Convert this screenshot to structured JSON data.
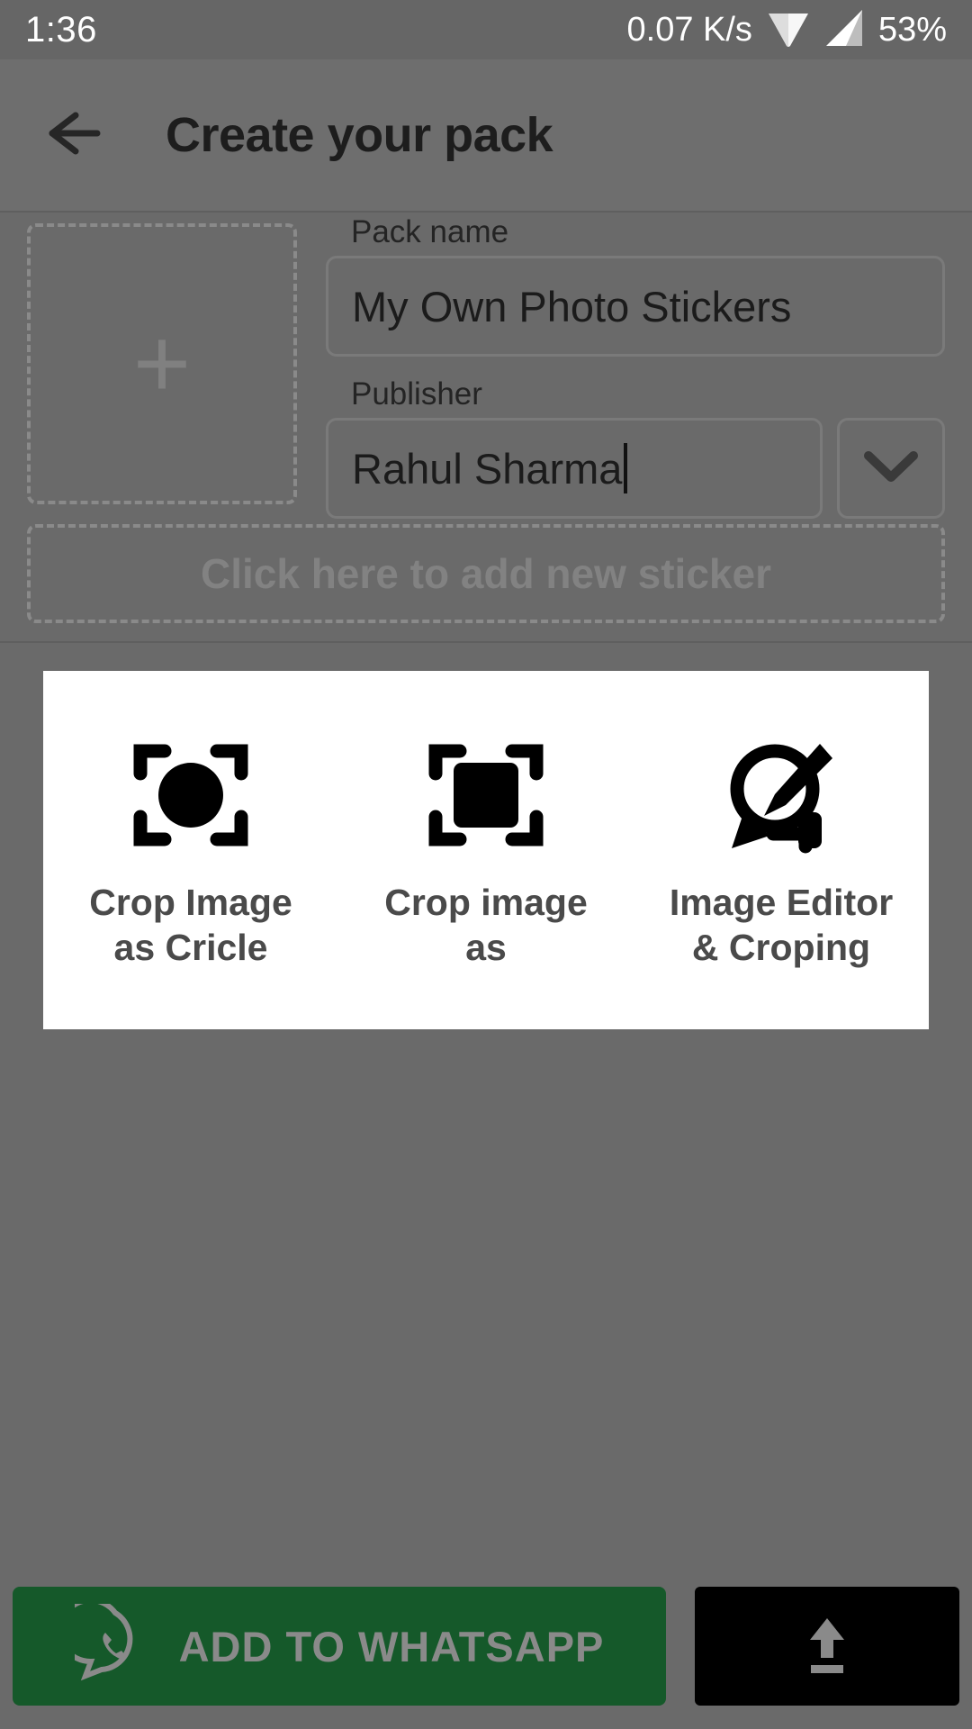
{
  "status_bar": {
    "time": "1:36",
    "network_speed": "0.07 K/s",
    "battery": "53%",
    "wifi_icon": "wifi-icon",
    "signal_icon": "signal-icon"
  },
  "header": {
    "back_icon": "back-arrow-icon",
    "title": "Create your pack"
  },
  "form": {
    "thumbnail_add_icon": "plus-icon",
    "pack_name": {
      "label": "Pack name",
      "value": "My Own Photo Stickers"
    },
    "publisher": {
      "label": "Publisher",
      "value": "Rahul Sharma",
      "dropdown_icon": "chevron-down-icon"
    },
    "add_sticker_text": "Click here to add new sticker"
  },
  "dialog": {
    "options": [
      {
        "label": "Crop Image as Cricle",
        "icon": "crop-circle-icon"
      },
      {
        "label": "Crop image as",
        "icon": "crop-square-icon"
      },
      {
        "label": "Image Editor & Croping",
        "icon": "image-editor-pen-icon"
      }
    ]
  },
  "bottom_bar": {
    "whatsapp_button": {
      "label": "ADD TO WHATSAPP",
      "icon": "whatsapp-icon",
      "color": "#15592a"
    },
    "upload_button": {
      "icon": "upload-icon",
      "color": "#000000"
    }
  }
}
